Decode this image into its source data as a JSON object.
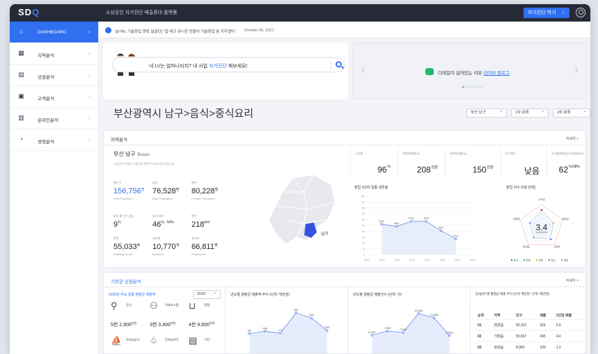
{
  "app": {
    "logo": "SDQ",
    "title": "소상공인 자가진단 매출증대 플랫폼",
    "diagnose_btn": "자가진단 하기"
  },
  "sidebar": {
    "items": [
      {
        "label": "DASHBOARD",
        "icon": "home-icon",
        "active": true
      },
      {
        "label": "지역분석",
        "icon": "region-icon"
      },
      {
        "label": "상권분석",
        "icon": "store-icon"
      },
      {
        "label": "고객분석",
        "icon": "customer-icon"
      },
      {
        "label": "온라인분석",
        "icon": "online-icon"
      },
      {
        "label": "경쟁분석",
        "icon": "pie-icon"
      }
    ]
  },
  "news": {
    "text": "[ETRI, 기술창업 멘토 발굴단] \"집 테크 유니콘 만들어 기술창업 꿈 키우겠다\"",
    "date": "October 05, 2021"
  },
  "banner_left": {
    "text_before": "내 LV는 얼마나되지? 내 사업 ",
    "text_highlight": "자가진단",
    "text_after": " 해보세요!"
  },
  "banner_right": {
    "text_before": "디테일이 살아있는 리뷰 ",
    "text_highlight": "네이버 블로그"
  },
  "page_title": "부산광역시 남구>음식>중식요리",
  "filters": [
    "부산 남구",
    "1차 분류",
    "2차 분류"
  ],
  "region": {
    "title": "지역분석",
    "more": "자세히 >",
    "name": "부산 남구",
    "name_en": "Busan",
    "desc": "기장군이 특정은 산업단지 위주로 조성 되어 있습니다",
    "kpis": [
      {
        "key": "총인구",
        "value": "156,756",
        "unit": "명",
        "sub": "Total Population",
        "blue": true
      },
      {
        "key": "남자",
        "value": "76,528",
        "unit": "명",
        "sub": "Male Population"
      },
      {
        "key": "여자",
        "value": "80,228",
        "unit": "명",
        "sub": "Female Population"
      },
      {
        "key": "외국 총 인구 (명)",
        "value": "9",
        "unit": "%",
        "sub": ""
      },
      {
        "key": "남녀 성비",
        "value": "46",
        "unit": "% : 54%",
        "sub": ""
      },
      {
        "key": "면적",
        "value": "218",
        "unit": "km²",
        "sub": ""
      },
      {
        "key": "주택",
        "value": "55,033",
        "unit": "호",
        "sub": "Dwelling House"
      },
      {
        "key": "사업체",
        "value": "10,770",
        "unit": "개",
        "sub": "Business"
      },
      {
        "key": "종사자",
        "value": "66,811",
        "unit": "명",
        "sub": "Practicioner"
      }
    ],
    "map_label": "남구",
    "stats": [
      {
        "key": "소상율",
        "value": "96",
        "unit": "%"
      },
      {
        "key": "지출액(월평균)",
        "value": "208",
        "unit": "만원"
      },
      {
        "key": "임대료(월평균)",
        "value": "150",
        "unit": "만원"
      },
      {
        "key": "인구밀도",
        "value": "낮음",
        "unit": ""
      },
      {
        "key": "소상활성화(감소)/창업(감소)",
        "value": "62",
        "unit": "%/38%"
      }
    ]
  },
  "chart_data": [
    {
      "type": "line",
      "title": "창업 3년차 업종 생존율",
      "x": [
        "2013",
        "2014",
        "2015",
        "2016",
        "2017",
        "2018",
        "2019",
        "2020"
      ],
      "y": [
        52,
        48,
        57,
        57,
        41,
        27
      ],
      "ylabels": [
        "100",
        "90",
        "80",
        "70",
        "60",
        "50",
        "40",
        "30",
        "20",
        "10",
        "0"
      ]
    },
    {
      "type": "radar",
      "title": "창업 지수 (5점 만점)",
      "center_value": "3.4",
      "axes": [
        "수익성",
        "성장성",
        "고립도",
        "임대료",
        "안정성"
      ],
      "legend": [
        "음식",
        "판매",
        "보통",
        "경고",
        "위험"
      ]
    },
    {
      "type": "line",
      "title": "년도별 월평균 매출액 추이 (단위: 백만원)",
      "x": [],
      "y": [
        167,
        186,
        171,
        342,
        299,
        193
      ]
    },
    {
      "type": "line",
      "title": "년도별 월평균 매출건수 (단위: 건)",
      "x": [],
      "y": [
        6120,
        7542,
        7038,
        13450,
        12006,
        5994
      ]
    }
  ],
  "biz": {
    "title": "기장군 상권분석",
    "more": "자세히 >",
    "col1_title": "2020년 주요 업종 월평균 매출액",
    "year": "2020",
    "categories": [
      {
        "icon": "cup-icon",
        "label": "음식",
        "value": "5천 2,900",
        "unit": "만원"
      },
      {
        "icon": "hanger-icon",
        "label": "의류&소품",
        "value": "3천 3,400",
        "unit": "만원"
      },
      {
        "icon": "cart-icon",
        "label": "생활",
        "value": "4천 9,600",
        "unit": "만원"
      }
    ],
    "categories2": [
      {
        "icon": "ship-icon",
        "label": "숙박&음식"
      },
      {
        "icon": "culture-icon",
        "label": "문화&취미"
      },
      {
        "icon": "etc-icon",
        "label": "기타"
      }
    ],
    "col4_title": "동/읍/면 별 월평균 매출 추이 (단위 백만원 / 단위: 백만원)",
    "table_headers": [
      "순위",
      "지역",
      "인구",
      "매출",
      "1인당 매출"
    ],
    "table_rows": [
      [
        "01",
        "점관읍",
        "83,116",
        "324",
        "3.9"
      ],
      [
        "02",
        "기장읍",
        "55,567",
        "245",
        "4.4"
      ],
      [
        "03",
        "정관읍",
        "8,965",
        "109",
        "1.2"
      ]
    ]
  }
}
